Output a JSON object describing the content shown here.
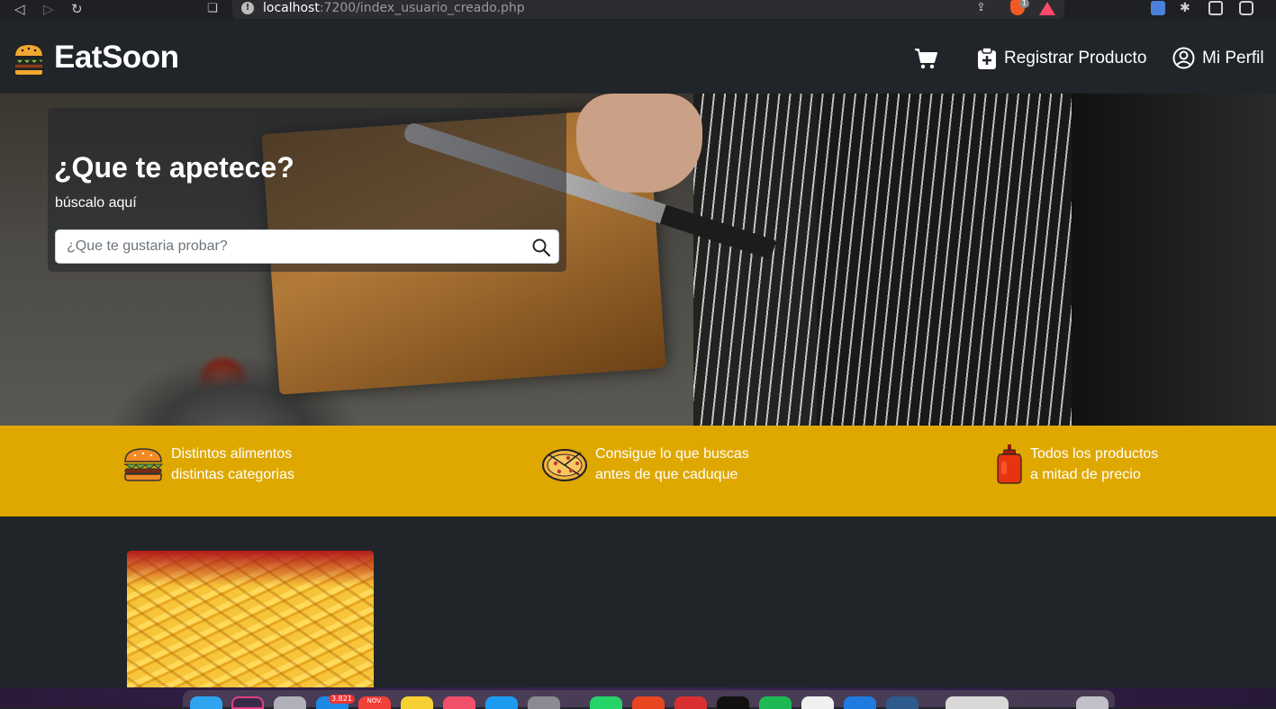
{
  "browser": {
    "url_host": "localhost",
    "url_rest": ":7200/index_usuario_creado.php",
    "brave_badge": "1"
  },
  "header": {
    "brand": "EatSoon",
    "register_label": "Registrar Producto",
    "profile_label": "Mi Perfil"
  },
  "hero": {
    "title": "¿Que te apetece?",
    "subtitle": "búscalo aquí",
    "search_placeholder": "¿Que te gustaria probar?"
  },
  "features": [
    {
      "icon": "burger-icon",
      "line1": "Distintos alimentos",
      "line2": "distintas categorias"
    },
    {
      "icon": "pizza-icon",
      "line1": "Consigue lo que buscas",
      "line2": "antes de que caduque"
    },
    {
      "icon": "ketchup-icon",
      "line1": "Todos los productos",
      "line2": "a mitad de precio"
    }
  ],
  "products": [
    {
      "image": "french-fries-photo"
    }
  ],
  "dock": {
    "mail_badge": "3.821",
    "calendar_label": "NOV."
  },
  "colors": {
    "header_bg": "#212529",
    "features_bg": "#dfa800",
    "text": "#ffffff"
  }
}
